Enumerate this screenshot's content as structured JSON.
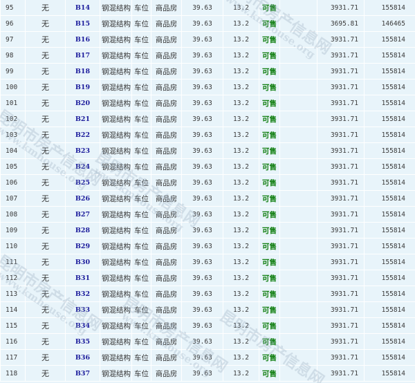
{
  "rows": [
    {
      "num": "95",
      "none": "无",
      "room": "B14",
      "struct": "钢混结构",
      "use": "车位",
      "ptype": "商品房",
      "area": "39.63",
      "ratio": "13.2",
      "status": "可售",
      "price": "3931.71",
      "total": "155814"
    },
    {
      "num": "96",
      "none": "无",
      "room": "B15",
      "struct": "钢混结构",
      "use": "车位",
      "ptype": "商品房",
      "area": "39.63",
      "ratio": "13.2",
      "status": "可售",
      "price": "3695.81",
      "total": "146465"
    },
    {
      "num": "97",
      "none": "无",
      "room": "B16",
      "struct": "钢混结构",
      "use": "车位",
      "ptype": "商品房",
      "area": "39.63",
      "ratio": "13.2",
      "status": "可售",
      "price": "3931.71",
      "total": "155814"
    },
    {
      "num": "98",
      "none": "无",
      "room": "B17",
      "struct": "钢混结构",
      "use": "车位",
      "ptype": "商品房",
      "area": "39.63",
      "ratio": "13.2",
      "status": "可售",
      "price": "3931.71",
      "total": "155814"
    },
    {
      "num": "99",
      "none": "无",
      "room": "B18",
      "struct": "钢混结构",
      "use": "车位",
      "ptype": "商品房",
      "area": "39.63",
      "ratio": "13.2",
      "status": "可售",
      "price": "3931.71",
      "total": "155814"
    },
    {
      "num": "100",
      "none": "无",
      "room": "B19",
      "struct": "钢混结构",
      "use": "车位",
      "ptype": "商品房",
      "area": "39.63",
      "ratio": "13.2",
      "status": "可售",
      "price": "3931.71",
      "total": "155814"
    },
    {
      "num": "101",
      "none": "无",
      "room": "B20",
      "struct": "钢混结构",
      "use": "车位",
      "ptype": "商品房",
      "area": "39.63",
      "ratio": "13.2",
      "status": "可售",
      "price": "3931.71",
      "total": "155814"
    },
    {
      "num": "102",
      "none": "无",
      "room": "B21",
      "struct": "钢混结构",
      "use": "车位",
      "ptype": "商品房",
      "area": "39.63",
      "ratio": "13.2",
      "status": "可售",
      "price": "3931.71",
      "total": "155814"
    },
    {
      "num": "103",
      "none": "无",
      "room": "B22",
      "struct": "钢混结构",
      "use": "车位",
      "ptype": "商品房",
      "area": "39.63",
      "ratio": "13.2",
      "status": "可售",
      "price": "3931.71",
      "total": "155814"
    },
    {
      "num": "104",
      "none": "无",
      "room": "B23",
      "struct": "钢混结构",
      "use": "车位",
      "ptype": "商品房",
      "area": "39.63",
      "ratio": "13.2",
      "status": "可售",
      "price": "3931.71",
      "total": "155814"
    },
    {
      "num": "105",
      "none": "无",
      "room": "B24",
      "struct": "钢混结构",
      "use": "车位",
      "ptype": "商品房",
      "area": "39.63",
      "ratio": "13.2",
      "status": "可售",
      "price": "3931.71",
      "total": "155814"
    },
    {
      "num": "106",
      "none": "无",
      "room": "B25",
      "struct": "钢混结构",
      "use": "车位",
      "ptype": "商品房",
      "area": "39.63",
      "ratio": "13.2",
      "status": "可售",
      "price": "3931.71",
      "total": "155814"
    },
    {
      "num": "107",
      "none": "无",
      "room": "B26",
      "struct": "钢混结构",
      "use": "车位",
      "ptype": "商品房",
      "area": "39.63",
      "ratio": "13.2",
      "status": "可售",
      "price": "3931.71",
      "total": "155814"
    },
    {
      "num": "108",
      "none": "无",
      "room": "B27",
      "struct": "钢混结构",
      "use": "车位",
      "ptype": "商品房",
      "area": "39.63",
      "ratio": "13.2",
      "status": "可售",
      "price": "3931.71",
      "total": "155814"
    },
    {
      "num": "109",
      "none": "无",
      "room": "B28",
      "struct": "钢混结构",
      "use": "车位",
      "ptype": "商品房",
      "area": "39.63",
      "ratio": "13.2",
      "status": "可售",
      "price": "3931.71",
      "total": "155814"
    },
    {
      "num": "110",
      "none": "无",
      "room": "B29",
      "struct": "钢混结构",
      "use": "车位",
      "ptype": "商品房",
      "area": "39.63",
      "ratio": "13.2",
      "status": "可售",
      "price": "3931.71",
      "total": "155814"
    },
    {
      "num": "111",
      "none": "无",
      "room": "B30",
      "struct": "钢混结构",
      "use": "车位",
      "ptype": "商品房",
      "area": "39.63",
      "ratio": "13.2",
      "status": "可售",
      "price": "3931.71",
      "total": "155814"
    },
    {
      "num": "112",
      "none": "无",
      "room": "B31",
      "struct": "钢混结构",
      "use": "车位",
      "ptype": "商品房",
      "area": "39.63",
      "ratio": "13.2",
      "status": "可售",
      "price": "3931.71",
      "total": "155814"
    },
    {
      "num": "113",
      "none": "无",
      "room": "B32",
      "struct": "钢混结构",
      "use": "车位",
      "ptype": "商品房",
      "area": "39.63",
      "ratio": "13.2",
      "status": "可售",
      "price": "3931.71",
      "total": "155814"
    },
    {
      "num": "114",
      "none": "无",
      "room": "B33",
      "struct": "钢混结构",
      "use": "车位",
      "ptype": "商品房",
      "area": "39.63",
      "ratio": "13.2",
      "status": "可售",
      "price": "3931.71",
      "total": "155814"
    },
    {
      "num": "115",
      "none": "无",
      "room": "B34",
      "struct": "钢混结构",
      "use": "车位",
      "ptype": "商品房",
      "area": "39.63",
      "ratio": "13.2",
      "status": "可售",
      "price": "3931.71",
      "total": "155814"
    },
    {
      "num": "116",
      "none": "无",
      "room": "B35",
      "struct": "钢混结构",
      "use": "车位",
      "ptype": "商品房",
      "area": "39.63",
      "ratio": "13.2",
      "status": "可售",
      "price": "3931.71",
      "total": "155814"
    },
    {
      "num": "117",
      "none": "无",
      "room": "B36",
      "struct": "钢混结构",
      "use": "车位",
      "ptype": "商品房",
      "area": "39.63",
      "ratio": "13.2",
      "status": "可售",
      "price": "3931.71",
      "total": "155814"
    },
    {
      "num": "118",
      "none": "无",
      "room": "B37",
      "struct": "钢混结构",
      "use": "车位",
      "ptype": "商品房",
      "area": "39.63",
      "ratio": "13.2",
      "status": "可售",
      "price": "3931.71",
      "total": "155814"
    }
  ],
  "watermark": {
    "cn": "昆明市房产信息网",
    "en": "www.kmhouse.org"
  },
  "colors": {
    "row_bg": "#e8f4fa",
    "grid_line": "#ffffff",
    "room_text": "#1c1c9c",
    "status_text": "#0e7d0e"
  }
}
